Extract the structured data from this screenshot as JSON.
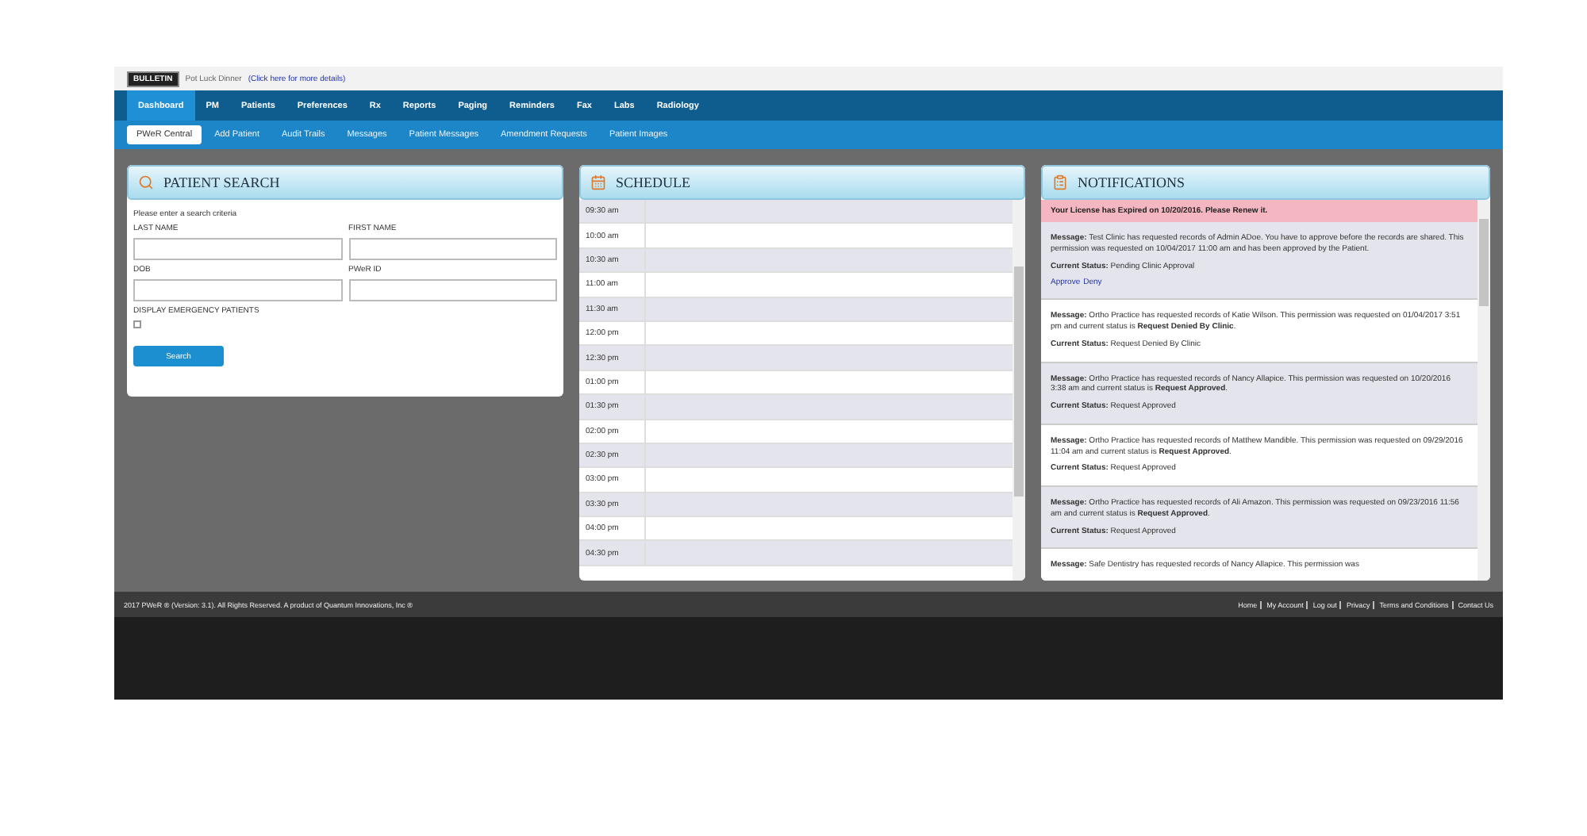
{
  "top_bar": {
    "logo": "BULLETIN",
    "announcement": "Pot Luck Dinner",
    "details_link": "(Click here for more details)"
  },
  "main_nav": [
    {
      "label": "Dashboard",
      "selected": true
    },
    {
      "label": "PM",
      "selected": false
    },
    {
      "label": "Patients",
      "selected": false
    },
    {
      "label": "Preferences",
      "selected": false
    },
    {
      "label": "Rx",
      "selected": false
    },
    {
      "label": "Reports",
      "selected": false
    },
    {
      "label": "Paging",
      "selected": false
    },
    {
      "label": "Reminders",
      "selected": false
    },
    {
      "label": "Fax",
      "selected": false
    },
    {
      "label": "Labs",
      "selected": false
    },
    {
      "label": "Radiology",
      "selected": false
    }
  ],
  "sub_nav": [
    {
      "label": "PWeR Central",
      "selected": true
    },
    {
      "label": "Add Patient",
      "selected": false
    },
    {
      "label": "Audit Trails",
      "selected": false
    },
    {
      "label": "Messages",
      "selected": false
    },
    {
      "label": "Patient Messages",
      "selected": false
    },
    {
      "label": "Amendment Requests",
      "selected": false
    },
    {
      "label": "Patient Images",
      "selected": false
    }
  ],
  "patient_search": {
    "title": "PATIENT SEARCH",
    "intro": "Please enter a search criteria",
    "fields": [
      {
        "label": "LAST NAME"
      },
      {
        "label": "FIRST NAME"
      },
      {
        "label": "DOB"
      },
      {
        "label": "PWeR ID"
      }
    ],
    "emergency": {
      "label": "DISPLAY EMERGENCY PATIENTS",
      "checked": false
    },
    "button": "Search"
  },
  "schedule": {
    "title": "SCHEDULE",
    "times": [
      "09:30 am",
      "10:00 am",
      "10:30 am",
      "11:00 am",
      "11:30 am",
      "12:00 pm",
      "12:30 pm",
      "01:00 pm",
      "01:30 pm",
      "02:00 pm",
      "02:30 pm",
      "03:00 pm",
      "03:30 pm",
      "04:00 pm",
      "04:30 pm"
    ]
  },
  "notifications": {
    "title": "NOTIFICATIONS",
    "alert": "Your License has Expired on 10/20/2016. Please Renew it.",
    "items": [
      {
        "message": "**Message:** Test Clinic has requested records of Admin ADoe. You have to approve before the records are shared. This permission was requested on 10/04/2017 11:00 am and has been approved by the Patient.",
        "status": "**Current Status:** Pending Clinic Approval",
        "actions": [
          "Approve",
          "Deny"
        ]
      },
      {
        "message": "**Message:** Ortho Practice has requested records of Katie Wilson. This permission was requested on 01/04/2017 3:51 pm and current status is **Request Denied By Clinic**.",
        "status": "**Current Status:** Request Denied By Clinic"
      },
      {
        "message": "**Message:** Ortho Practice has requested records of Nancy Allapice. This permission was requested on 10/20/2016 3:38 am and current status is **Request Approved**.",
        "status": "**Current Status:** Request Approved"
      },
      {
        "message": "**Message:** Ortho Practice has requested records of Matthew Mandible. This permission was requested on 09/29/2016 11:04 am and current status is **Request Approved**.",
        "status": "**Current Status:** Request Approved"
      },
      {
        "message": "**Message:** Ortho Practice has requested records of Ali Amazon. This permission was requested on 09/23/2016 11:56 am and current status is **Request Approved**.",
        "status": "**Current Status:** Request Approved"
      },
      {
        "message": "**Message:** Safe Dentistry has requested records of Nancy Allapice. This permission was"
      }
    ]
  },
  "footer": {
    "copyright": "2017 PWeR ® (Version: 3.1). All Rights Reserved. A product of Quantum Innovations, Inc ®",
    "links": [
      "Home",
      "My Account",
      "Log out",
      "Privacy",
      "Terms and Conditions",
      "Contact Us"
    ]
  }
}
